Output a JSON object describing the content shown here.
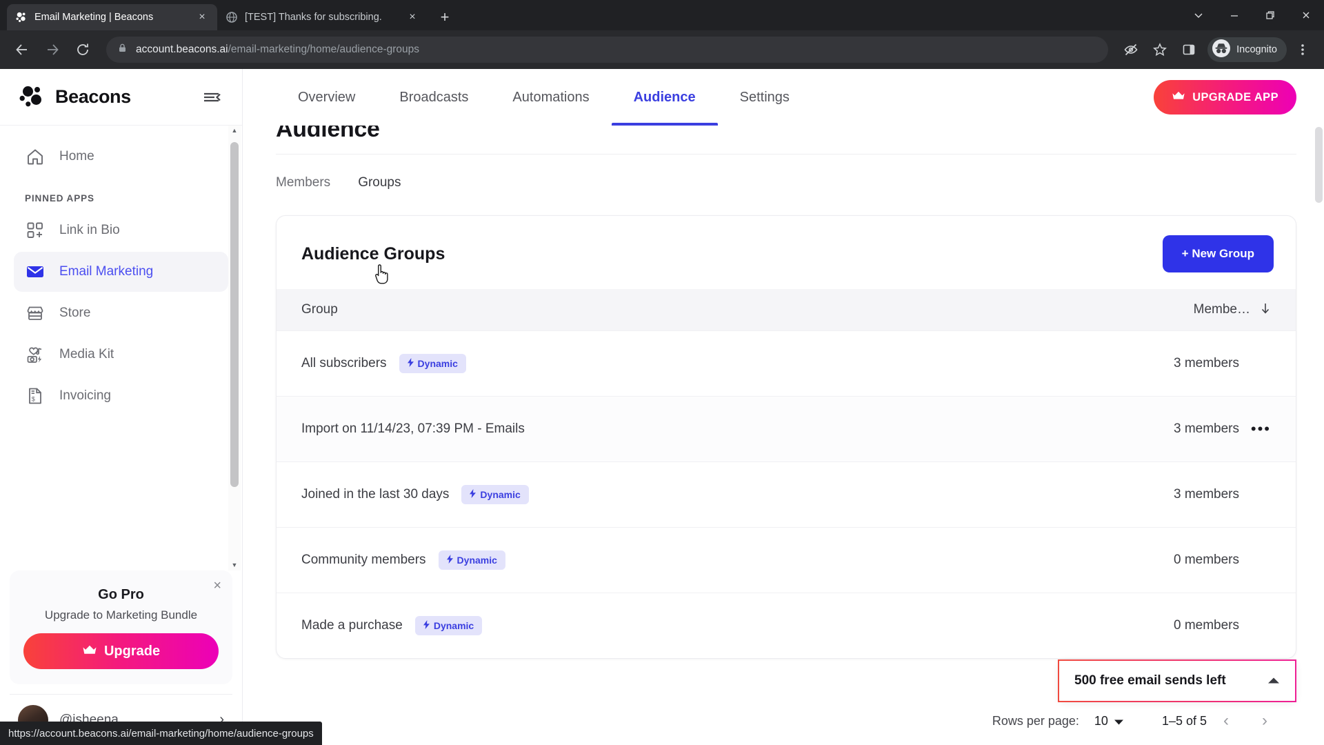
{
  "browser": {
    "tabs": [
      {
        "title": "Email Marketing | Beacons",
        "favicon": "beacons-icon",
        "active": true,
        "close_label": "×"
      },
      {
        "title": "[TEST] Thanks for subscribing.",
        "favicon": "globe-icon",
        "active": false,
        "close_label": "×"
      }
    ],
    "new_tab_label": "+",
    "window_controls": {
      "tab_search": "tab-search-icon",
      "minimize": "minimize-icon",
      "maximize": "maximize-icon",
      "close": "close-icon"
    },
    "toolbar": {
      "back": "back-arrow-icon",
      "forward": "forward-arrow-icon",
      "reload": "reload-icon",
      "lock": "lock-icon",
      "url_domain": "account.beacons.ai",
      "url_path": "/email-marketing/home/audience-groups",
      "third_party_cookie": "eye-off-icon",
      "bookmark": "star-icon",
      "side_panel": "side-panel-icon",
      "incognito_label": "Incognito",
      "menu": "three-dot-menu-icon"
    },
    "status_bar_url": "https://account.beacons.ai/email-marketing/home/audience-groups"
  },
  "sidebar": {
    "brand": "Beacons",
    "collapse_icon": "collapse-sidebar-icon",
    "home": {
      "label": "Home",
      "icon": "home-icon"
    },
    "section_label": "PINNED APPS",
    "items": [
      {
        "label": "Link in Bio",
        "icon": "link-in-bio-icon",
        "active": false
      },
      {
        "label": "Email Marketing",
        "icon": "envelope-icon",
        "active": true
      },
      {
        "label": "Store",
        "icon": "store-icon",
        "active": false
      },
      {
        "label": "Media Kit",
        "icon": "media-kit-icon",
        "active": false
      },
      {
        "label": "Invoicing",
        "icon": "invoice-icon",
        "active": false
      }
    ],
    "promo": {
      "title": "Go Pro",
      "subtitle": "Upgrade to Marketing Bundle",
      "button": "Upgrade",
      "button_icon": "crown-icon",
      "close_icon": "close-icon"
    },
    "profile": {
      "handle": "@jsheena",
      "chevron": "chevron-right-icon"
    }
  },
  "topnav": {
    "items": [
      {
        "label": "Overview",
        "active": false
      },
      {
        "label": "Broadcasts",
        "active": false
      },
      {
        "label": "Automations",
        "active": false
      },
      {
        "label": "Audience",
        "active": true
      },
      {
        "label": "Settings",
        "active": false
      }
    ],
    "upgrade_button": "UPGRADE APP",
    "upgrade_icon": "crown-icon"
  },
  "main": {
    "page_title": "Audience",
    "subtabs": [
      {
        "label": "Members",
        "current": false
      },
      {
        "label": "Groups",
        "current": true
      }
    ],
    "card": {
      "title": "Audience Groups",
      "new_group_button": "+ New Group",
      "columns": {
        "group": "Group",
        "members": "Membe…",
        "sort_icon": "sort-descending-arrow"
      },
      "rows": [
        {
          "name": "All subscribers",
          "badge": "Dynamic",
          "badge_icon": "lightning-icon",
          "count": "3 members",
          "menu": "",
          "hovered": false
        },
        {
          "name": "Import on 11/14/23, 07:39 PM - Emails",
          "badge": "",
          "badge_icon": "",
          "count": "3 members",
          "menu": "•••",
          "hovered": true
        },
        {
          "name": "Joined in the last 30 days",
          "badge": "Dynamic",
          "badge_icon": "lightning-icon",
          "count": "3 members",
          "menu": "",
          "hovered": false
        },
        {
          "name": "Community members",
          "badge": "Dynamic",
          "badge_icon": "lightning-icon",
          "count": "0 members",
          "menu": "",
          "hovered": false
        },
        {
          "name": "Made a purchase",
          "badge": "Dynamic",
          "badge_icon": "lightning-icon",
          "count": "0 members",
          "menu": "",
          "hovered": false
        }
      ]
    },
    "pagination": {
      "rows_per_page_label": "Rows per page:",
      "rows_per_page_value": "10",
      "dropdown_icon": "caret-down-icon",
      "range": "1–5 of 5",
      "prev_icon": "‹",
      "next_icon": "›"
    },
    "sends_pill": {
      "text": "500 free email sends left",
      "caret_icon": "caret-up-icon"
    }
  },
  "colors": {
    "brand_blue": "#3b3fe0",
    "button_blue": "#2f33e8",
    "badge_bg": "#e3e3fb",
    "gradient_start": "#f9423a",
    "gradient_end": "#ed00b6",
    "chrome_dark": "#202124"
  }
}
